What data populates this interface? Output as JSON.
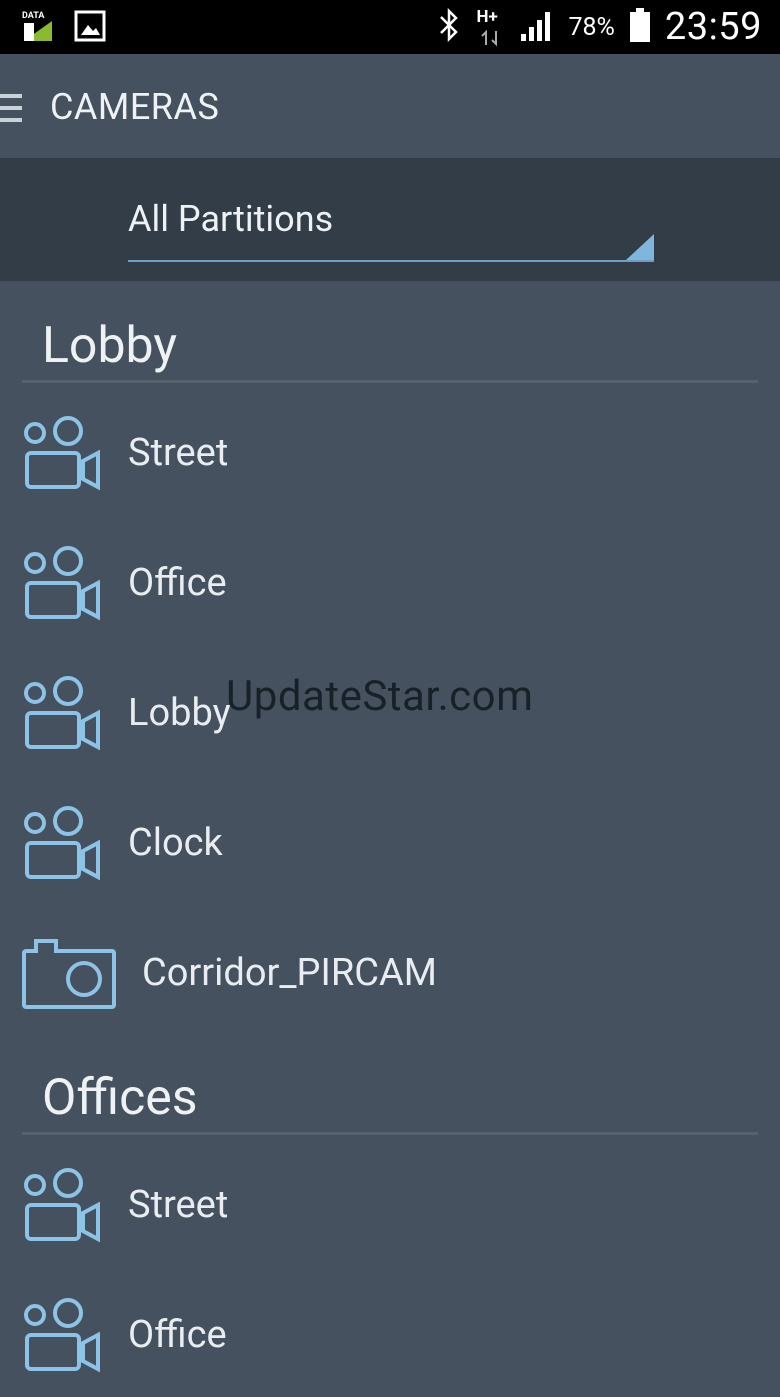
{
  "status_bar": {
    "data_label": "DATA",
    "network_label": "H+",
    "battery_percent": "78%",
    "time": "23:59",
    "icons": [
      "data-icon",
      "image-icon",
      "bluetooth-icon",
      "network-arrows-icon",
      "signal-icon",
      "battery-icon"
    ]
  },
  "app_bar": {
    "title": "CAMERAS",
    "menu_icon": "hamburger-menu-icon"
  },
  "filter": {
    "selected": "All Partitions"
  },
  "sections": [
    {
      "title": "Lobby",
      "items": [
        {
          "label": "Street",
          "icon": "video-camera-icon"
        },
        {
          "label": "Office",
          "icon": "video-camera-icon"
        },
        {
          "label": "Lobby",
          "icon": "video-camera-icon"
        },
        {
          "label": "Clock",
          "icon": "video-camera-icon"
        },
        {
          "label": "Corridor_PIRCAM",
          "icon": "still-camera-icon"
        }
      ]
    },
    {
      "title": "Offices",
      "items": [
        {
          "label": "Street",
          "icon": "video-camera-icon"
        },
        {
          "label": "Office",
          "icon": "video-camera-icon"
        }
      ]
    }
  ],
  "watermark": "UpdateStar.com",
  "colors": {
    "background": "#45515f",
    "filter_bar": "#333d48",
    "accent": "#6e9fc2",
    "icon": "#8cc3e6",
    "text": "#e9edf1"
  }
}
